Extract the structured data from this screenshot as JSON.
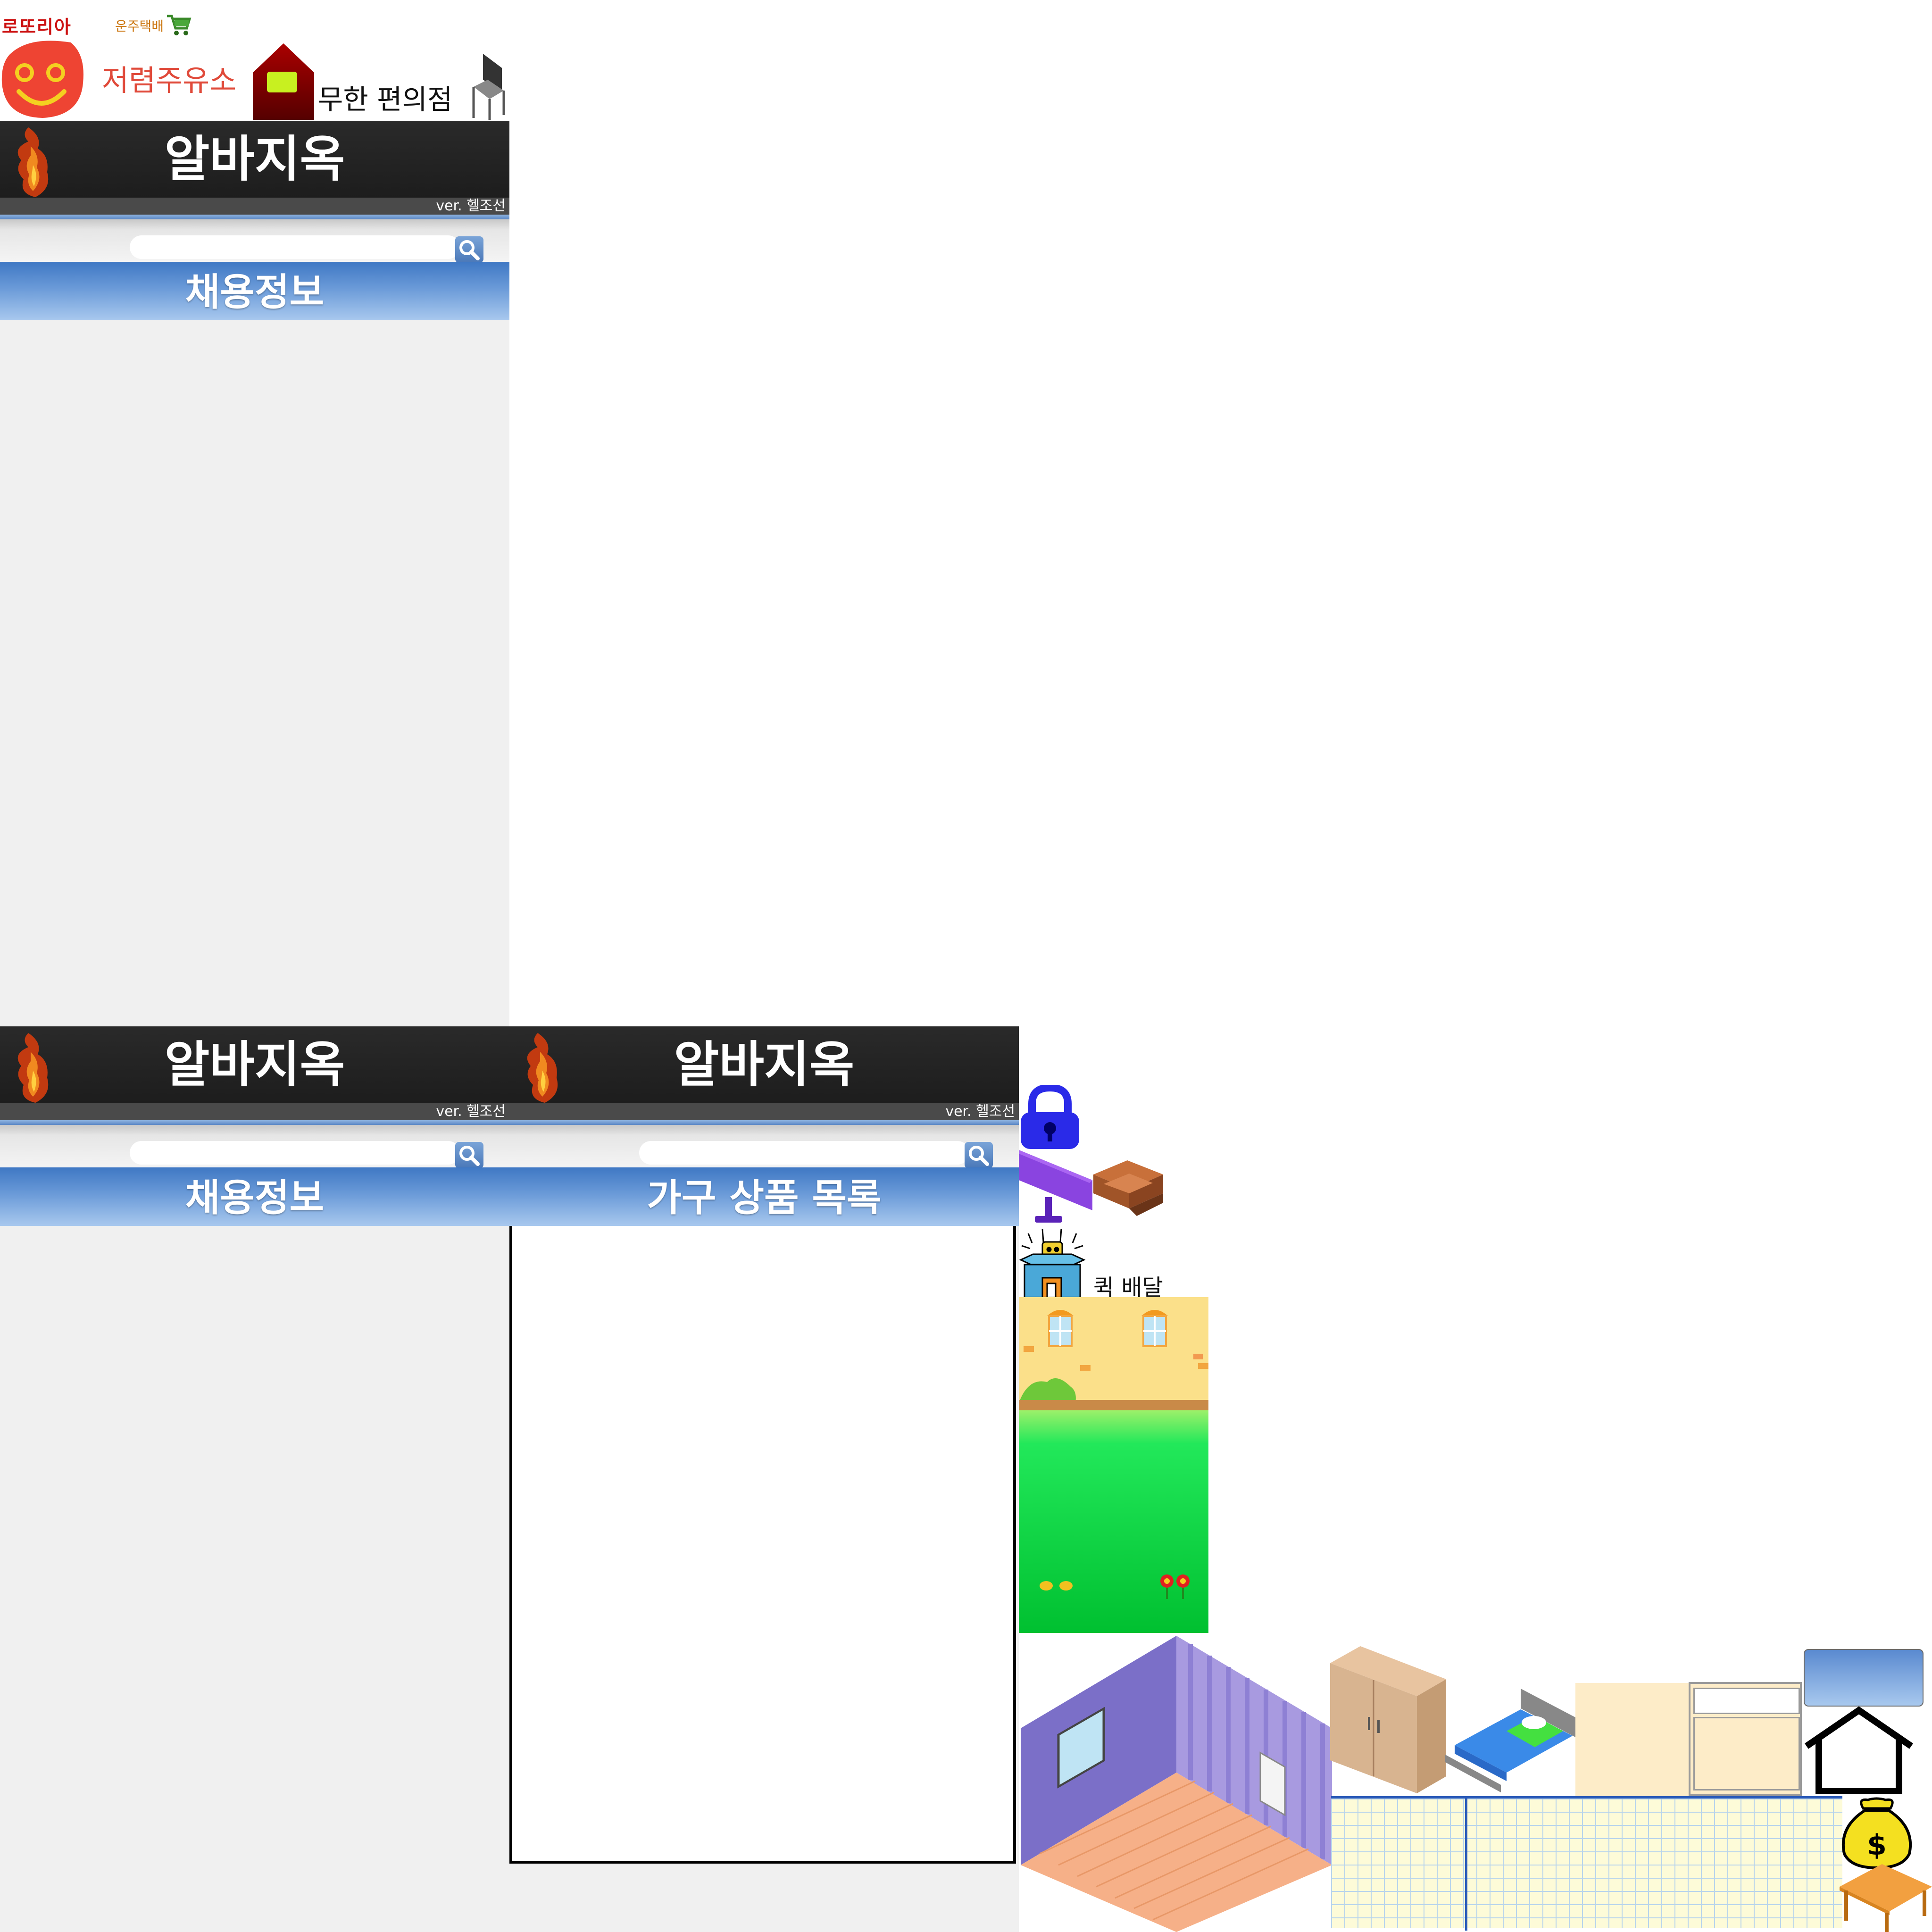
{
  "shortcuts": {
    "lotteria_label": "로또리아",
    "delivery_label": "운주택배",
    "gas_label": "저렴주유소",
    "convenience_label": "무한 편의점"
  },
  "panels": {
    "title": "알바지옥",
    "version": "ver. 헬조선",
    "jobs_section": "채용정보",
    "furniture_section": "가구 상품 목록",
    "search_placeholder": ""
  },
  "quick_delivery_label": "퀵 배달",
  "colors": {
    "header_bg": "#1f1f1f",
    "section_blue": "#5a8fd6",
    "panel_bg": "#f0f0f0",
    "lock_blue": "#2a2ae8",
    "smile_red": "#ee4433"
  },
  "icons": [
    "smile-face-icon",
    "cart-icon",
    "red-house-icon",
    "chair-icon",
    "flame-map-icon",
    "search-icon",
    "lock-icon",
    "monitor-icon",
    "sofa-icon",
    "delivery-box-icon",
    "money-bag-icon",
    "house-outline-icon",
    "table-icon",
    "wardrobe-icon",
    "bed-icon"
  ]
}
